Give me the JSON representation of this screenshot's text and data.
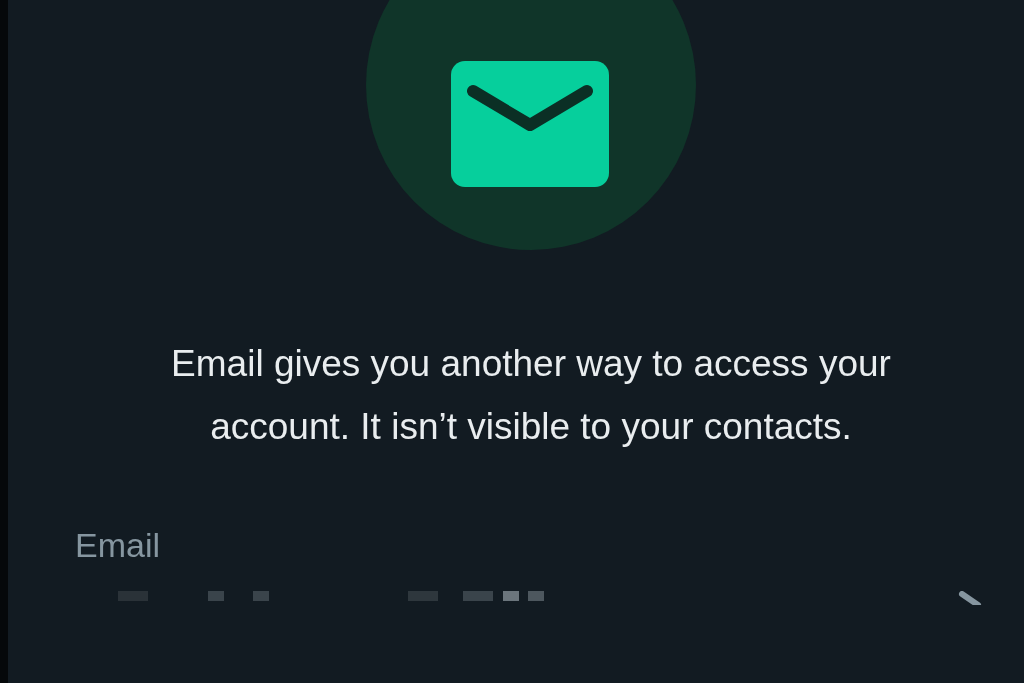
{
  "message": "Email gives you another way to access your account. It isn’t visible to your contacts.",
  "email_field": {
    "label": "Email"
  }
}
